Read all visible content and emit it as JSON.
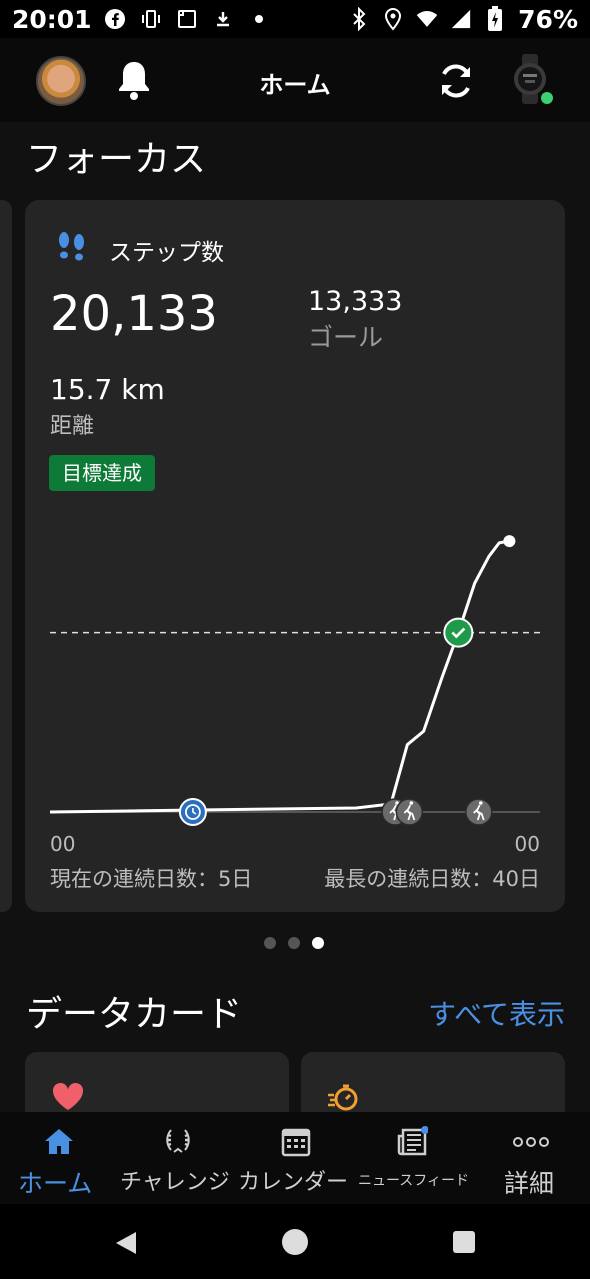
{
  "status_bar": {
    "time": "20:01",
    "battery": "76%",
    "left_icons": [
      "facebook-icon",
      "vibrate-icon",
      "screenshot-icon",
      "download-icon",
      "dot-icon"
    ],
    "right_icons": [
      "bluetooth-icon",
      "location-icon",
      "wifi-icon",
      "signal-icon",
      "battery-charging-icon"
    ]
  },
  "header": {
    "title": "ホーム",
    "watch_connected_color": "#3cd070"
  },
  "focus": {
    "section_title": "フォーカス",
    "card_title": "ステップ数",
    "steps": "20,133",
    "goal_value": "13,333",
    "goal_label": "ゴール",
    "distance_value": "15.7 km",
    "distance_label": "距離",
    "badge": "目標達成",
    "axis_start": "00",
    "axis_end": "00",
    "streak_current": "現在の連続日数：5日",
    "streak_longest": "最長の連続日数：40日",
    "accent_green": "#0e7a37",
    "chart_data": {
      "type": "line",
      "x_label_start": "00",
      "x_label_end": "00",
      "goal": 13333,
      "ylim": [
        0,
        21700
      ],
      "x_hours": [
        0,
        5,
        10,
        15,
        16.7,
        17.5,
        18.3,
        19.2,
        20,
        20.8,
        21.5,
        22,
        22.5
      ],
      "values": [
        0,
        100,
        200,
        300,
        600,
        5000,
        6000,
        10000,
        13333,
        17000,
        19000,
        20000,
        20133
      ],
      "markers": [
        {
          "type": "timer",
          "x_hour": 7
        },
        {
          "type": "walk",
          "x_hour": 16.9
        },
        {
          "type": "walk",
          "x_hour": 17.6
        },
        {
          "type": "walk",
          "x_hour": 21.0
        },
        {
          "type": "goal-check",
          "x_hour": 20.0
        }
      ],
      "end_marker_color": "#ffffff"
    }
  },
  "pager": {
    "count": 3,
    "active": 2
  },
  "data_cards": {
    "title": "データカード",
    "see_all": "すべて表示",
    "cards": [
      {
        "icon": "heart-icon",
        "color": "#f0606a"
      },
      {
        "icon": "stopwatch-icon",
        "color": "#f0a030"
      }
    ]
  },
  "bottom_nav": {
    "active_color": "#4a90e2",
    "items": [
      {
        "label": "ホーム",
        "icon": "home-icon"
      },
      {
        "label": "チャレンジ",
        "icon": "laurel-icon"
      },
      {
        "label": "カレンダー",
        "icon": "calendar-icon"
      },
      {
        "label": "ニュースフィード",
        "icon": "newsfeed-icon"
      },
      {
        "label": "詳細",
        "icon": "more-icon"
      }
    ]
  }
}
